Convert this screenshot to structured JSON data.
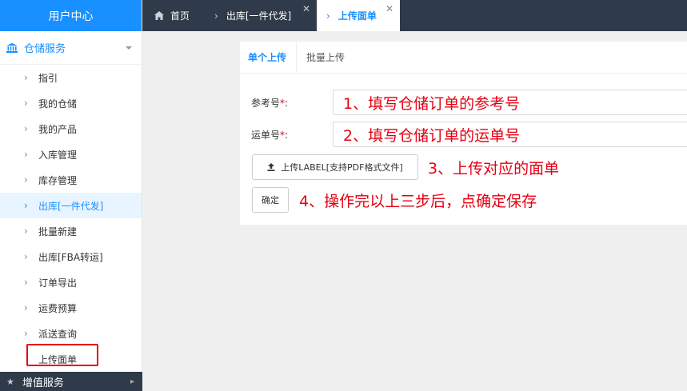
{
  "sidebar": {
    "title": "用户中心",
    "group": {
      "label": "仓储服务",
      "icon": "bank-icon"
    },
    "items": [
      {
        "label": "指引"
      },
      {
        "label": "我的仓储"
      },
      {
        "label": "我的产品"
      },
      {
        "label": "入库管理"
      },
      {
        "label": "库存管理"
      },
      {
        "label": "出库[一件代发]",
        "active": true
      },
      {
        "label": "批量新建"
      },
      {
        "label": "出库[FBA转运]"
      },
      {
        "label": "订单导出"
      },
      {
        "label": "运费预算"
      },
      {
        "label": "派送查询"
      },
      {
        "label": "上传面单"
      }
    ],
    "bottom_group": {
      "label": "增值服务",
      "icon": "star-icon"
    }
  },
  "tabs": [
    {
      "label": "首页",
      "icon": "home-icon"
    },
    {
      "label": "出库[一件代发]",
      "closable": true
    },
    {
      "label": "上传面单",
      "closable": true,
      "active": true
    }
  ],
  "subtabs": [
    {
      "label": "单个上传",
      "active": true
    },
    {
      "label": "批量上传"
    }
  ],
  "form": {
    "ref_label": "参考号",
    "ref_required_mark": "*",
    "ref_colon": ":",
    "waybill_label": "运单号",
    "waybill_required_mark": "*",
    "waybill_colon": ":",
    "upload_button": "上传LABEL[支持PDF格式文件]",
    "confirm_button": "确定"
  },
  "annotations": {
    "step1": "1、填写仓储订单的参考号",
    "step2": "2、填写仓储订单的运单号",
    "step3": "3、上传对应的面单",
    "step4": "4、操作完以上三步后，点确定保存"
  },
  "colors": {
    "accent": "#1890ff",
    "annotation": "#e60012",
    "dark_bar": "#2f3a4a"
  }
}
